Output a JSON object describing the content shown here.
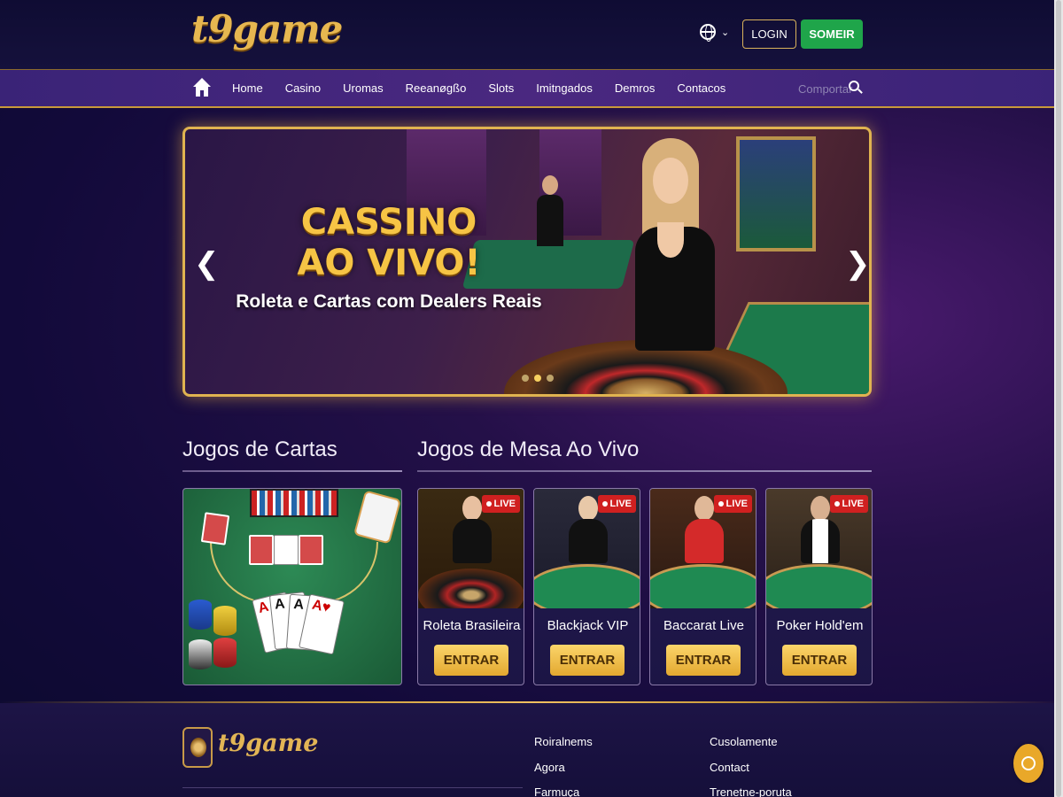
{
  "header": {
    "logo": "t9game",
    "login_label": "LOGIN",
    "signup_label": "SOMEIR"
  },
  "nav": {
    "items": [
      "Home",
      "Casino",
      "Uromas",
      "Reeanøgßo",
      "Slots",
      "Imitngados",
      "Demros",
      "Contacos"
    ],
    "search_label": "Comportar"
  },
  "banner": {
    "title_line1": "CASSINO",
    "title_line2": "AO VIVO!",
    "subtitle": "Roleta e Cartas com Dealers Reais",
    "slides": 3,
    "active_slide": 2
  },
  "sections": {
    "cards_title": "Jogos de Cartas",
    "live_title": "Jogos de Mesa Ao Vivo"
  },
  "live_games": [
    {
      "name": "Roleta Brasileira",
      "badge": "LIVE",
      "button": "ENTRAR"
    },
    {
      "name": "Blackjack VIP",
      "badge": "LIVE",
      "button": "ENTRAR"
    },
    {
      "name": "Baccarat Live",
      "badge": "LIVE",
      "button": "ENTRAR"
    },
    {
      "name": "Poker Hold'em",
      "badge": "LIVE",
      "button": "ENTRAR"
    }
  ],
  "footer": {
    "logo": "t9game",
    "col1": [
      "Roiralnems",
      "Agora",
      "Farmuça"
    ],
    "col2": [
      "Cusolamente",
      "Contact",
      "Trenetne-poruta"
    ]
  },
  "colors": {
    "gold": "#e7b750",
    "signup_green": "#1fa54a",
    "live_red": "#d02020",
    "nav_purple": "#3a2377"
  }
}
